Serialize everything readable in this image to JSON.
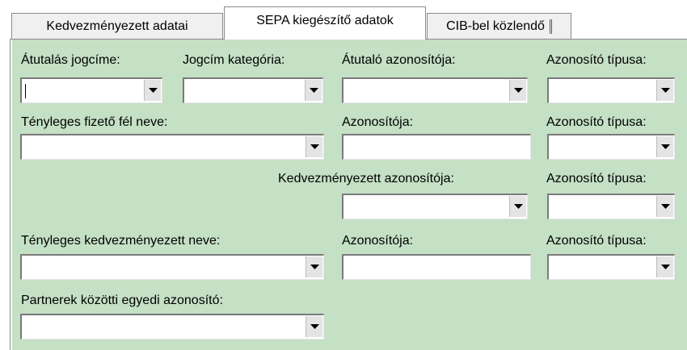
{
  "tabs": [
    {
      "label": "Kedvezményezett adatai",
      "active": false
    },
    {
      "label": "SEPA kiegészítő adatok",
      "active": true
    },
    {
      "label": "CIB-bel közlendő",
      "active": false
    }
  ],
  "form": {
    "atutalas_jogcime": {
      "label": "Átutalás jogcíme:",
      "value": ""
    },
    "jogcim_kategoria": {
      "label": "Jogcím kategória:",
      "value": ""
    },
    "atutalo_azonositoja": {
      "label": "Átutaló azonosítója:",
      "value": ""
    },
    "azonosito_tipusa_1": {
      "label": "Azonosító típusa:",
      "value": ""
    },
    "tenyleges_fizeto_fel_neve": {
      "label": "Tényleges fizető fél neve:",
      "value": ""
    },
    "fizeto_azonositoja": {
      "label": "Azonosítója:",
      "value": ""
    },
    "azonosito_tipusa_2": {
      "label": "Azonosító típusa:",
      "value": ""
    },
    "kedvezmenyezett_azonositoja": {
      "label": "Kedvezményezett azonosítója:",
      "value": ""
    },
    "azonosito_tipusa_3": {
      "label": "Azonosító típusa:",
      "value": ""
    },
    "tenyleges_kedvezmenyezett_neve": {
      "label": "Tényleges kedvezményezett neve:",
      "value": ""
    },
    "kedvezmenyezett_azonosito_text": {
      "label": "Azonosítója:",
      "value": ""
    },
    "azonosito_tipusa_4": {
      "label": "Azonosító típusa:",
      "value": ""
    },
    "partnerek_egyedi_azonosito": {
      "label": "Partnerek közötti egyedi azonosító:",
      "value": ""
    }
  },
  "colors": {
    "panel": "#c4e0c5",
    "tab_inactive": "#f0f0f0",
    "tab_active": "#ffffff"
  }
}
